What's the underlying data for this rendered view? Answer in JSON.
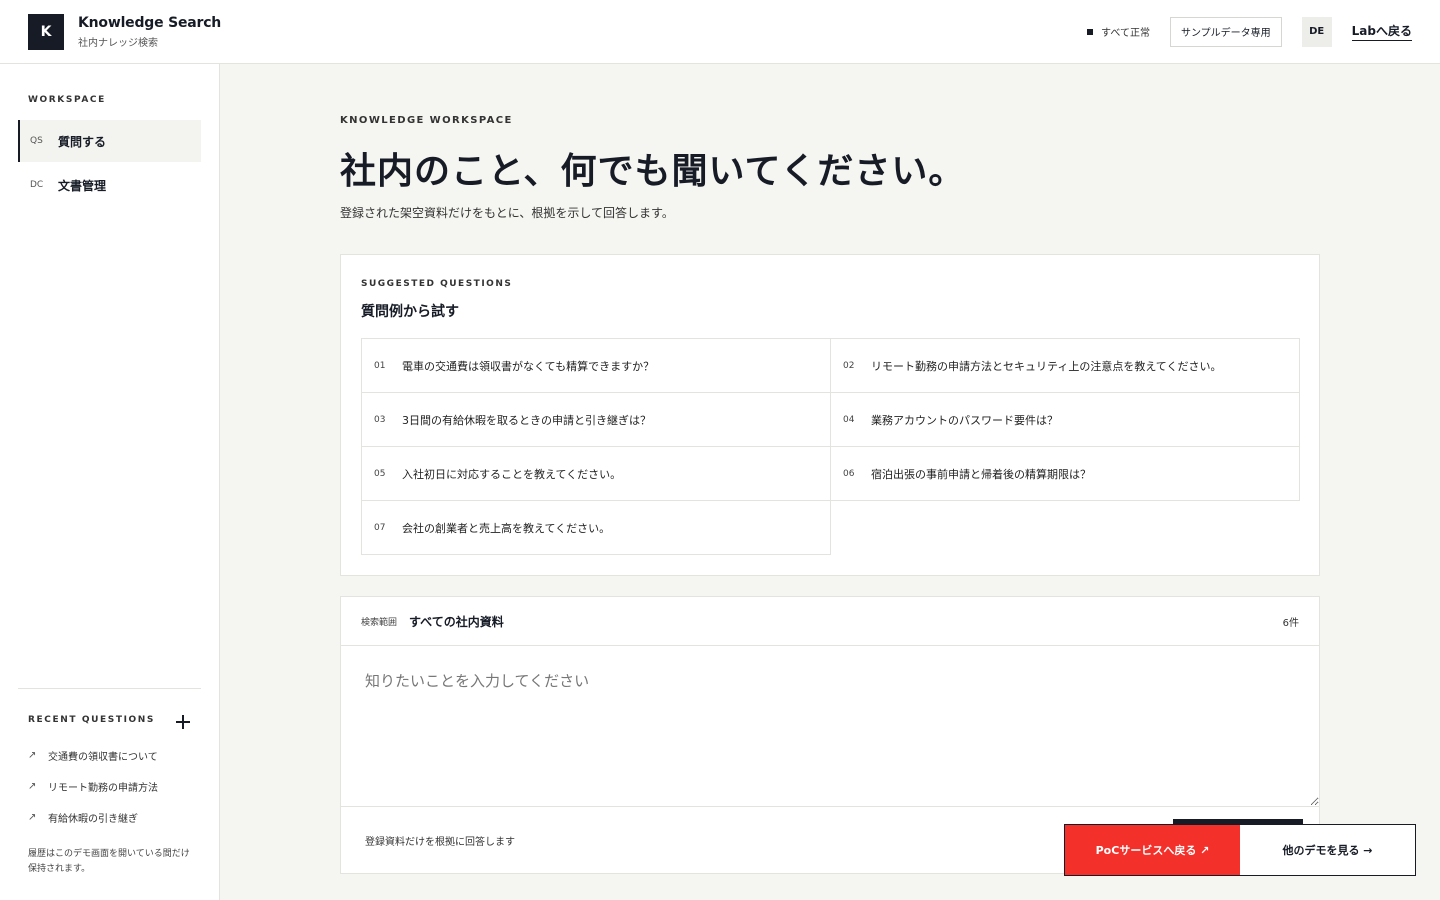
{
  "header": {
    "logo_letter": "K",
    "title": "Knowledge Search",
    "subtitle": "社内ナレッジ検索",
    "status": "すべて正常",
    "sample_badge": "サンプルデータ専用",
    "lang": "DE",
    "back_link": "Labへ戻る"
  },
  "sidebar": {
    "section_label": "WORKSPACE",
    "items": [
      {
        "code": "QS",
        "label": "質問する"
      },
      {
        "code": "DC",
        "label": "文書管理"
      }
    ],
    "recent_label": "RECENT QUESTIONS",
    "recent_items": [
      {
        "arrow": "↗",
        "label": "交通費の領収書について"
      },
      {
        "arrow": "↗",
        "label": "リモート勤務の申請方法"
      },
      {
        "arrow": "↗",
        "label": "有給休暇の引き継ぎ"
      }
    ],
    "history_note": "履歴はこのデモ画面を開いている間だけ保持されます。"
  },
  "main": {
    "eyebrow": "KNOWLEDGE WORKSPACE",
    "title": "社内のこと、何でも聞いてください。",
    "subtitle": "登録された架空資料だけをもとに、根拠を示して回答します。",
    "suggested": {
      "eyebrow": "SUGGESTED QUESTIONS",
      "title": "質問例から試す",
      "questions": [
        {
          "num": "01",
          "text": "電車の交通費は領収書がなくても精算できますか？"
        },
        {
          "num": "02",
          "text": "リモート勤務の申請方法とセキュリティ上の注意点を教えてください。"
        },
        {
          "num": "03",
          "text": "3日間の有給休暇を取るときの申請と引き継ぎは？"
        },
        {
          "num": "04",
          "text": "業務アカウントのパスワード要件は？"
        },
        {
          "num": "05",
          "text": "入社初日に対応することを教えてください。"
        },
        {
          "num": "06",
          "text": "宿泊出張の事前申請と帰着後の精算期限は？"
        },
        {
          "num": "07",
          "text": "会社の創業者と売上高を教えてください。"
        }
      ]
    },
    "input": {
      "scope_label": "検索範囲",
      "scope_value": "すべての社内資料",
      "scope_count": "6件",
      "placeholder": "知りたいことを入力してください",
      "footer_note": "登録資料だけを根拠に回答します"
    }
  },
  "floating": {
    "poc_label": "PoCサービスへ戻る ↗",
    "demo_label": "他のデモを見る →"
  },
  "colors": {
    "accent_red": "#f3302a",
    "ink": "#161b26",
    "canvas": "#f5f5f1"
  }
}
